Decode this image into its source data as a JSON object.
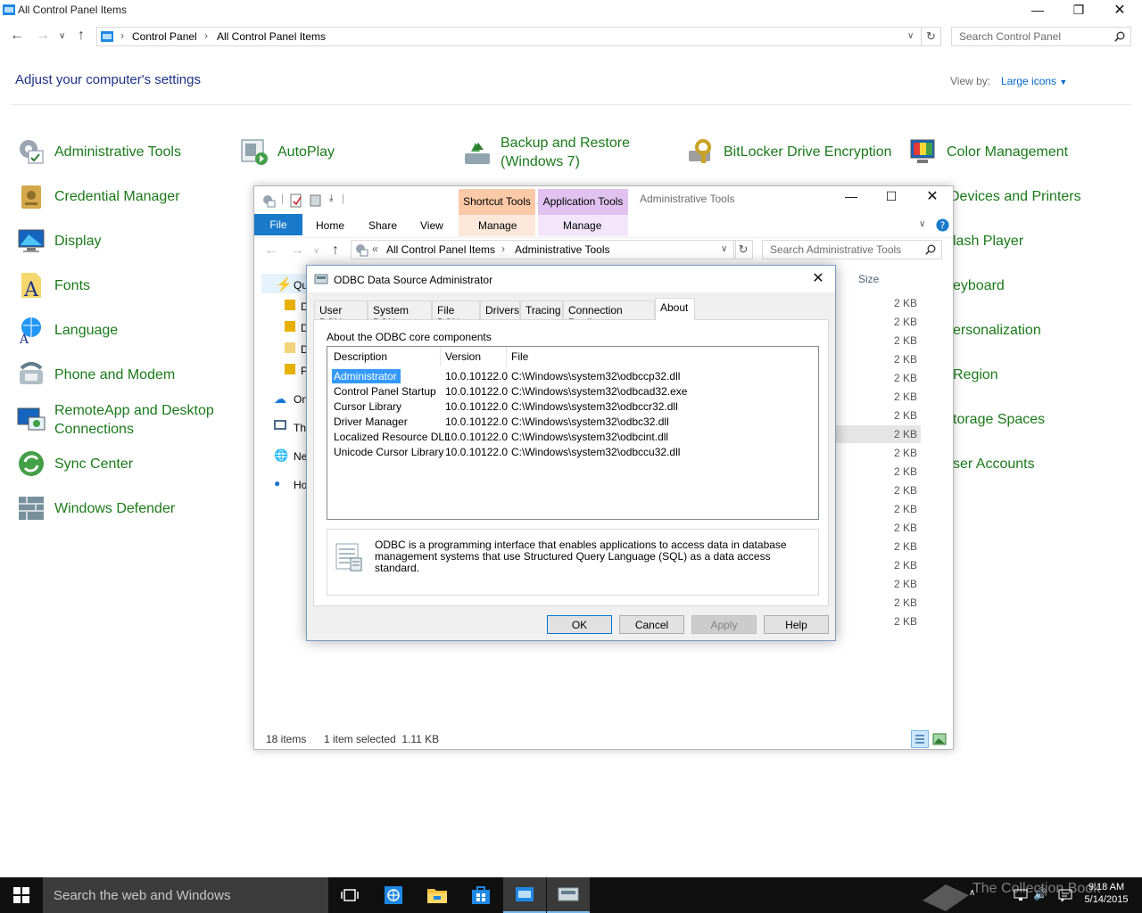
{
  "control_panel": {
    "window_title": "All Control Panel Items",
    "breadcrumb": [
      "Control Panel",
      "All Control Panel Items"
    ],
    "search_placeholder": "Search Control Panel",
    "heading": "Adjust your computer's settings",
    "view_by_label": "View by:",
    "view_by_value": "Large icons",
    "items_col1": [
      "Administrative Tools",
      "Credential Manager",
      "Display",
      "Fonts",
      "Language",
      "Phone and Modem",
      "RemoteApp and Desktop Connections",
      "Sync Center",
      "Windows Defender"
    ],
    "items_col2_top": "AutoPlay",
    "items_col3_top": "Backup and Restore (Windows 7)",
    "items_col4_top": "BitLocker Drive Encryption",
    "items_col5": [
      "Color Management",
      "Devices and Printers",
      "Flash Player",
      "Keyboard",
      "Personalization",
      "Region",
      "Storage Spaces",
      "User Accounts"
    ],
    "items_col5_visible": [
      "Color Management",
      "Devices and Printers",
      "lash Player",
      "eyboard",
      "ersonalization",
      "Region",
      "torage Spaces",
      "ser Accounts"
    ]
  },
  "explorer": {
    "title": "Administrative Tools",
    "context_tabs": [
      {
        "label": "Shortcut Tools",
        "sub": "Manage",
        "color": "#f9c9a8"
      },
      {
        "label": "Application Tools",
        "sub": "Manage",
        "color": "#e0c2f0"
      }
    ],
    "ribbon_tabs": [
      "File",
      "Home",
      "Share",
      "View"
    ],
    "breadcrumb": [
      "All Control Panel Items",
      "Administrative Tools"
    ],
    "search_placeholder": "Search Administrative Tools",
    "size_header": "Size",
    "sizes": [
      "2 KB",
      "2 KB",
      "2 KB",
      "2 KB",
      "2 KB",
      "2 KB",
      "2 KB",
      "2 KB",
      "2 KB",
      "2 KB",
      "2 KB",
      "2 KB",
      "2 KB",
      "2 KB",
      "2 KB",
      "2 KB",
      "2 KB",
      "2 KB"
    ],
    "nav_partial": [
      "Qu",
      "D",
      "D",
      "D",
      "P",
      "On",
      "Th",
      "Ne",
      "Ho"
    ],
    "status_items": "18 items",
    "status_selected": "1 item selected  1.11 KB"
  },
  "odbc": {
    "title": "ODBC Data Source Administrator",
    "tabs": [
      "User DSN",
      "System DSN",
      "File DSN",
      "Drivers",
      "Tracing",
      "Connection Pooling",
      "About"
    ],
    "active_tab": "About",
    "caption": "About the ODBC core components",
    "columns": [
      "Description",
      "Version",
      "File"
    ],
    "rows": [
      {
        "description": "Administrator",
        "version": "10.0.10122.0",
        "file": "C:\\Windows\\system32\\odbccp32.dll"
      },
      {
        "description": "Control Panel Startup",
        "version": "10.0.10122.0",
        "file": "C:\\Windows\\system32\\odbcad32.exe"
      },
      {
        "description": "Cursor Library",
        "version": "10.0.10122.0",
        "file": "C:\\Windows\\system32\\odbccr32.dll"
      },
      {
        "description": "Driver Manager",
        "version": "10.0.10122.0",
        "file": "C:\\Windows\\system32\\odbc32.dll"
      },
      {
        "description": "Localized Resource DLL",
        "version": "10.0.10122.0",
        "file": "C:\\Windows\\system32\\odbcint.dll"
      },
      {
        "description": "Unicode Cursor Library",
        "version": "10.0.10122.0",
        "file": "C:\\Windows\\system32\\odbccu32.dll"
      }
    ],
    "description_text": "ODBC is a programming interface that enables applications to access data in database management systems that use Structured Query Language (SQL) as a data access standard.",
    "buttons": {
      "ok": "OK",
      "cancel": "Cancel",
      "apply": "Apply",
      "help": "Help"
    }
  },
  "taskbar": {
    "search_placeholder": "Search the web and Windows",
    "time": "9:18 AM",
    "date": "5/14/2015",
    "watermark": "The Collection Book"
  },
  "colors": {
    "link_green": "#1a7a1a",
    "heading_blue": "#1e3287",
    "accent": "#0078d7",
    "file_tab": "#1979ca"
  }
}
